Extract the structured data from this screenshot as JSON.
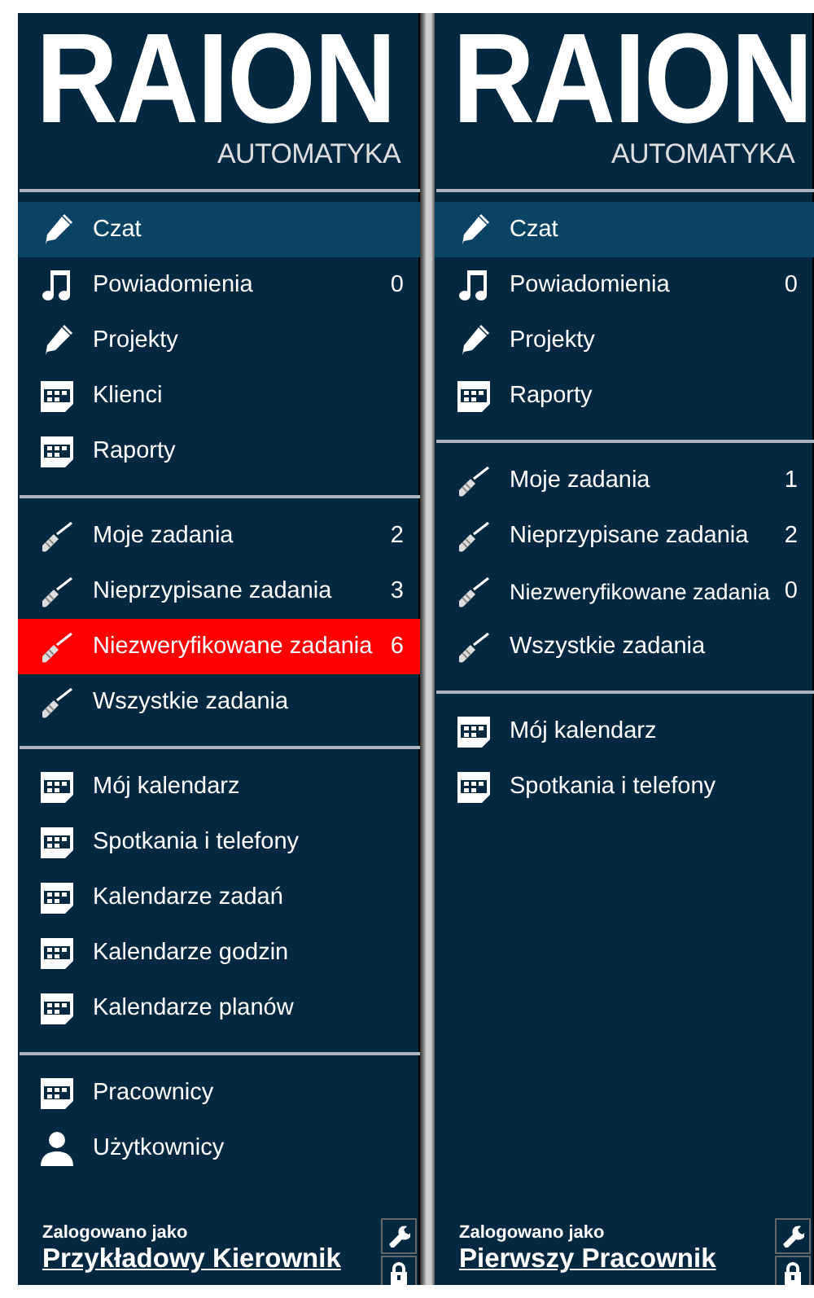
{
  "panels": [
    {
      "logo": {
        "title": "RAION",
        "subtitle": "AUTOMATYKA"
      },
      "sections": [
        [
          {
            "kind": "pencil",
            "label": "Czat",
            "selected": true,
            "alert": false
          },
          {
            "kind": "music",
            "label": "Powiadomienia",
            "count": "0",
            "selected": false,
            "alert": false
          },
          {
            "kind": "pencil",
            "label": "Projekty",
            "selected": false,
            "alert": false
          },
          {
            "kind": "calendar",
            "label": "Klienci",
            "selected": false,
            "alert": false
          },
          {
            "kind": "calendar",
            "label": "Raporty",
            "selected": false,
            "alert": false
          }
        ],
        [
          {
            "kind": "screwdriver",
            "label": "Moje zadania",
            "count": "2",
            "selected": false,
            "alert": false
          },
          {
            "kind": "screwdriver",
            "label": "Nieprzypisane zadania",
            "count": "3",
            "selected": false,
            "alert": false
          },
          {
            "kind": "screwdriver",
            "label": "Niezweryfikowane zadania",
            "count": "6",
            "selected": false,
            "alert": true
          },
          {
            "kind": "screwdriver",
            "label": "Wszystkie zadania",
            "selected": false,
            "alert": false
          }
        ],
        [
          {
            "kind": "calendar",
            "label": "Mój kalendarz",
            "selected": false,
            "alert": false
          },
          {
            "kind": "calendar",
            "label": "Spotkania i telefony",
            "selected": false,
            "alert": false
          },
          {
            "kind": "calendar",
            "label": "Kalendarze zadań",
            "selected": false,
            "alert": false
          },
          {
            "kind": "calendar",
            "label": "Kalendarze godzin",
            "selected": false,
            "alert": false
          },
          {
            "kind": "calendar",
            "label": "Kalendarze planów",
            "selected": false,
            "alert": false
          }
        ],
        [
          {
            "kind": "calendar",
            "label": "Pracownicy",
            "selected": false,
            "alert": false
          },
          {
            "kind": "person",
            "label": "Użytkownicy",
            "selected": false,
            "alert": false
          }
        ]
      ],
      "footer": {
        "label": "Zalogowano jako",
        "user": "Przykładowy Kierownik"
      }
    },
    {
      "logo": {
        "title": "RAION",
        "subtitle": "AUTOMATYKA"
      },
      "sections": [
        [
          {
            "kind": "pencil",
            "label": "Czat",
            "selected": true,
            "alert": false
          },
          {
            "kind": "music",
            "label": "Powiadomienia",
            "count": "0",
            "selected": false,
            "alert": false
          },
          {
            "kind": "pencil",
            "label": "Projekty",
            "selected": false,
            "alert": false
          },
          {
            "kind": "calendar",
            "label": "Raporty",
            "selected": false,
            "alert": false
          }
        ],
        [
          {
            "kind": "screwdriver",
            "label": "Moje zadania",
            "count": "1",
            "selected": false,
            "alert": false
          },
          {
            "kind": "screwdriver",
            "label": "Nieprzypisane zadania",
            "count": "2",
            "selected": false,
            "alert": false
          },
          {
            "kind": "screwdriver",
            "label": "Niezweryfikowane zadania",
            "count": "0",
            "selected": false,
            "alert": false
          },
          {
            "kind": "screwdriver",
            "label": "Wszystkie zadania",
            "selected": false,
            "alert": false
          }
        ],
        [
          {
            "kind": "calendar",
            "label": "Mój kalendarz",
            "selected": false,
            "alert": false
          },
          {
            "kind": "calendar",
            "label": "Spotkania i telefony",
            "selected": false,
            "alert": false
          }
        ]
      ],
      "footer": {
        "label": "Zalogowano jako",
        "user": "Pierwszy Pracownik"
      }
    }
  ]
}
